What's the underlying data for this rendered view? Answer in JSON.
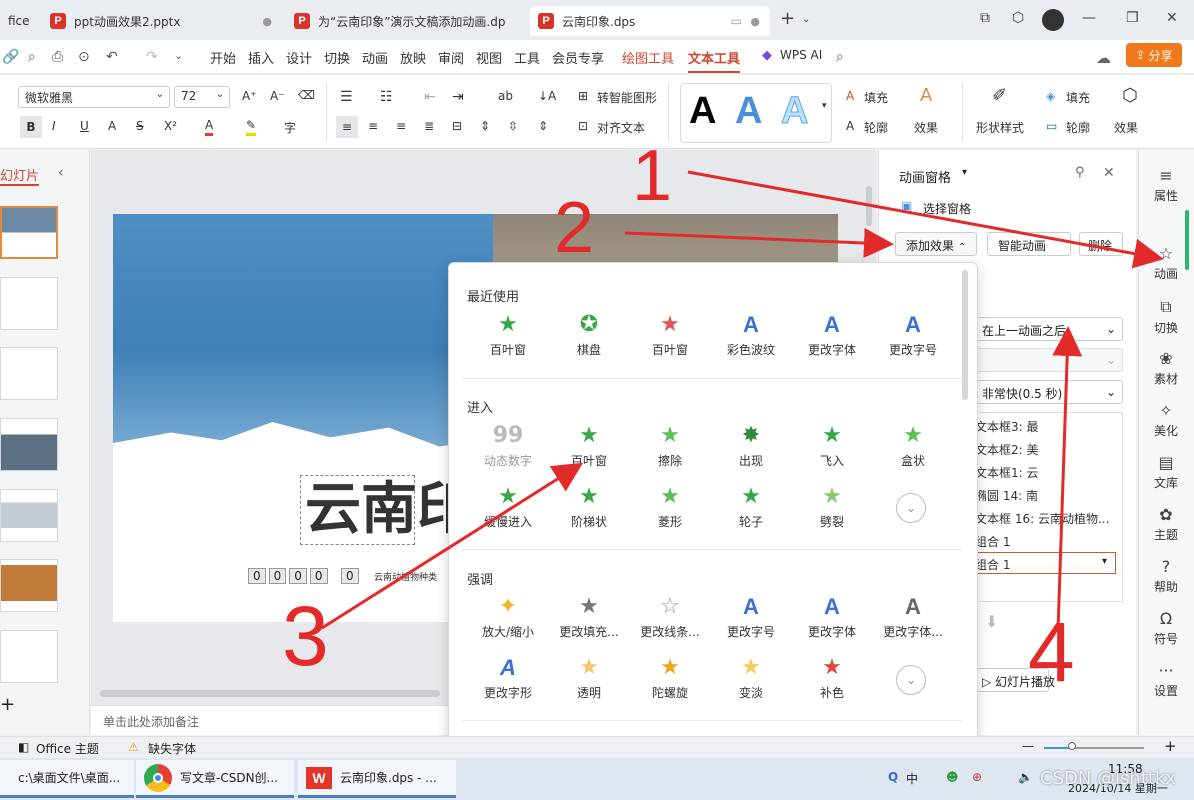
{
  "tabs": [
    {
      "label": "fice"
    },
    {
      "label": "ppt动画效果2.pptx"
    },
    {
      "label": "为“云南印象”演示文稿添加动画.dp"
    },
    {
      "label": "云南印象.dps"
    }
  ],
  "menu": [
    "开始",
    "插入",
    "设计",
    "切换",
    "动画",
    "放映",
    "审阅",
    "视图",
    "工具",
    "会员专享",
    "绘图工具",
    "文本工具",
    "WPS AI"
  ],
  "share_label": "分享",
  "ribbon": {
    "font_name": "微软雅黑",
    "font_size": "72",
    "smart_shape": "转智能图形",
    "align_text": "对齐文本",
    "fill1": "填充",
    "outline1": "轮廓",
    "effect1": "效果",
    "shape_style": "形状样式",
    "fill2": "填充",
    "outline2": "轮廓",
    "effect2": "效果",
    "wordart_glyph": "A"
  },
  "left_panel": {
    "title": "幻灯片"
  },
  "slide": {
    "title": "云南印",
    "caption": "云南动植物种类",
    "counter_digits": [
      "0",
      "0",
      "0",
      "0",
      "0"
    ]
  },
  "notes_placeholder": "单击此处添加备注",
  "anim_pane": {
    "title": "动画窗格",
    "select_pane": "选择窗格",
    "add_effect": "添加效果",
    "smart_anim": "智能动画",
    "delete": "删除",
    "start_value": "在上一动画之后",
    "speed_value": "非常快(0.5 秒)",
    "list": [
      "文本框3: 最",
      "文本框2: 美",
      "文本框1: 云",
      "椭圆 14: 南",
      "文本框 16: 云南动植物...",
      "组合 1",
      "组合 1"
    ],
    "slideshow": "幻灯片播放"
  },
  "rail": [
    "属性",
    "动画",
    "切换",
    "素材",
    "美化",
    "文库",
    "主题",
    "帮助",
    "符号",
    "设置"
  ],
  "dropdown": {
    "recent_title": "最近使用",
    "recent": [
      "百叶窗",
      "棋盘",
      "百叶窗",
      "彩色波纹",
      "更改字体",
      "更改字号"
    ],
    "enter_title": "进入",
    "enter": [
      "动态数字",
      "百叶窗",
      "擦除",
      "出现",
      "飞入",
      "盒状",
      "缓慢进入",
      "阶梯状",
      "菱形",
      "轮子",
      "劈裂"
    ],
    "emph_title": "强调",
    "emph": [
      "放大/缩小",
      "更改填充...",
      "更改线条...",
      "更改字号",
      "更改字体",
      "更改字体...",
      "更改字形",
      "透明",
      "陀螺旋",
      "变淡",
      "补色"
    ]
  },
  "status": {
    "theme": "Office 主题",
    "missing_font": "缺失字体"
  },
  "taskbar": {
    "items": [
      "c:\\桌面文件\\桌面...",
      "写文章-CSDN创...",
      "云南印象.dps - ..."
    ],
    "ime": "中",
    "time": "11:58",
    "date": "2024/10/14 星期一",
    "watermark": "CSDN @lshttkx"
  },
  "annotations": [
    "1",
    "2",
    "3",
    "4"
  ],
  "colors": {
    "accent": "#d0452f",
    "arrow": "#e32a2a",
    "share": "#f07a1b"
  }
}
